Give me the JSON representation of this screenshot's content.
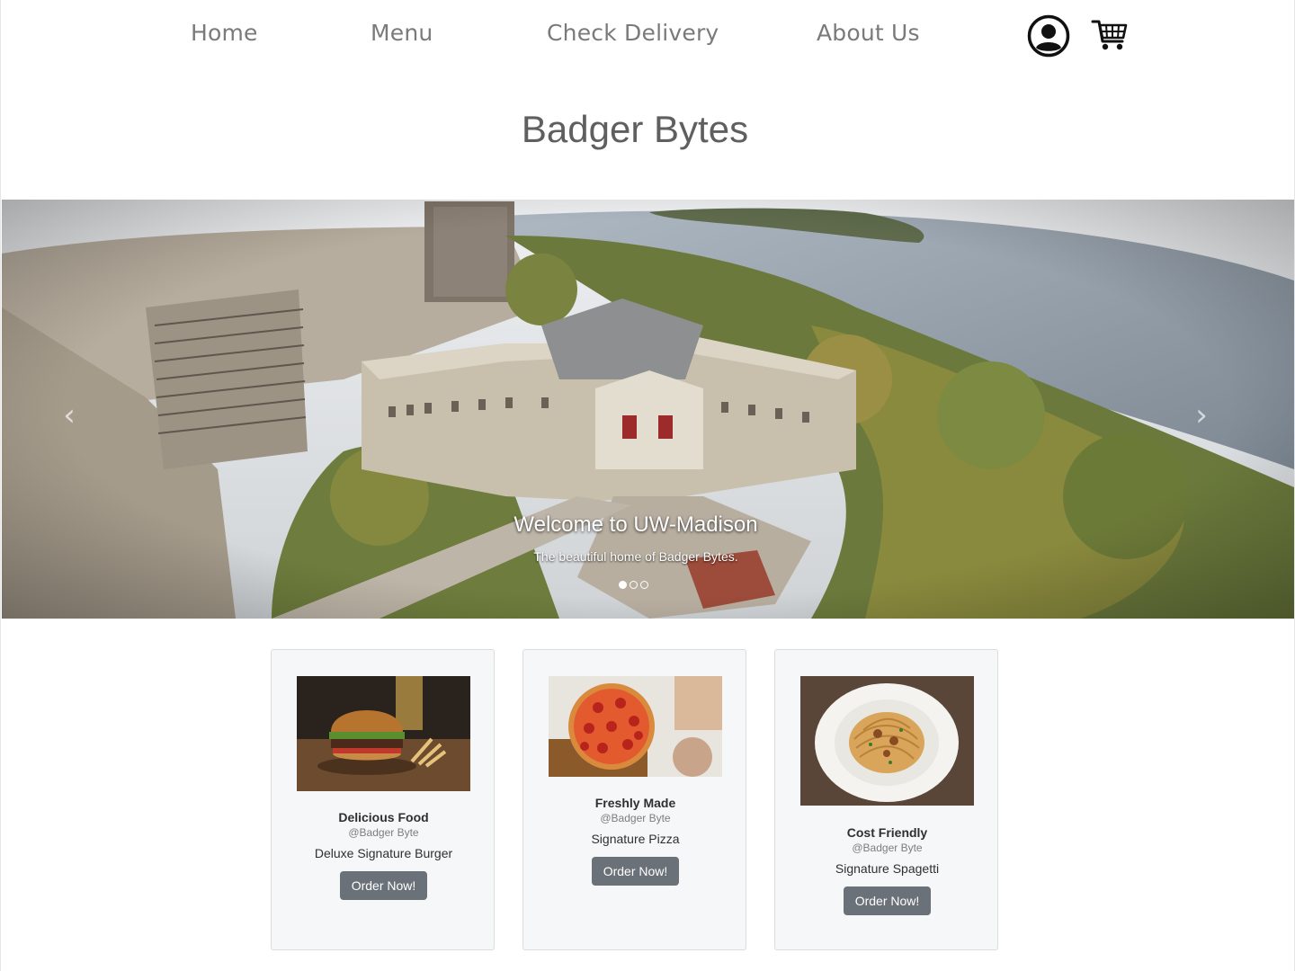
{
  "nav": {
    "links": [
      "Home",
      "Menu",
      "Check Delivery",
      "About Us"
    ],
    "icons": [
      "user-account-icon",
      "shopping-cart-icon"
    ]
  },
  "site_title": "Badger Bytes",
  "carousel": {
    "caption_title": "Welcome to UW-Madison",
    "caption_text": "The beautiful home of Badger Bytes.",
    "slide_count": 3,
    "active_slide": 1,
    "prev_icon": "chevron-left-icon",
    "next_icon": "chevron-right-icon"
  },
  "cards": [
    {
      "title": "Delicious Food",
      "subtitle": "@Badger Byte",
      "text": "Deluxe Signature Burger",
      "button": "Order Now!"
    },
    {
      "title": "Freshly Made",
      "subtitle": "@Badger Byte",
      "text": "Signature Pizza",
      "button": "Order Now!"
    },
    {
      "title": "Cost Friendly",
      "subtitle": "@Badger Byte",
      "text": "Signature Spagetti",
      "button": "Order Now!"
    }
  ],
  "colors": {
    "nav_text": "#7a7a7a",
    "title_text": "#5f5f5f",
    "button_bg": "#6b7178",
    "card_bg": "#f6f7f8"
  }
}
